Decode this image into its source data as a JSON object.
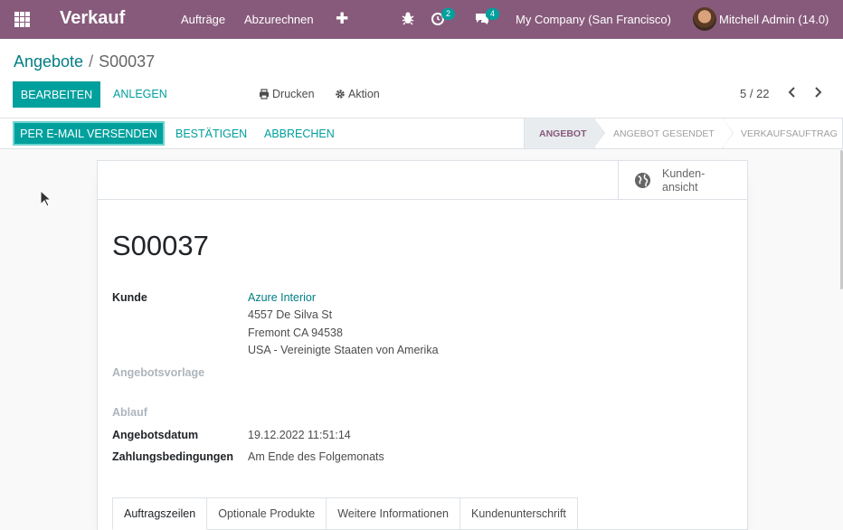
{
  "navbar": {
    "app_name": "Verkauf",
    "menu": [
      "Aufträge",
      "Abzurechnen"
    ],
    "activity_count": "2",
    "message_count": "4",
    "company": "My Company (San Francisco)",
    "user": "Mitchell Admin (14.0)"
  },
  "breadcrumb": {
    "parent": "Angebote",
    "separator": "/",
    "current": "S00037"
  },
  "actions": {
    "edit": "Bearbeiten",
    "create": "Anlegen",
    "print": "Drucken",
    "action": "Aktion"
  },
  "pager": "5 / 22",
  "status_buttons": {
    "send_email": "Per E-Mail versenden",
    "confirm": "Bestätigen",
    "cancel": "Abbrechen"
  },
  "stages": [
    "Angebot",
    "Angebot gesendet",
    "Verkaufsauftrag"
  ],
  "active_stage": "Angebot",
  "smart_button": {
    "label_line1": "Kunden-",
    "label_line2": "ansicht"
  },
  "record": {
    "name": "S00037",
    "customer_label": "Kunde",
    "customer_name": "Azure Interior",
    "address_line1": "4557 De Silva St",
    "address_line2": "Fremont CA 94538",
    "address_line3": "USA - Vereinigte Staaten von Amerika",
    "template_label": "Angebotsvorlage",
    "expiry_label": "Ablauf",
    "date_label": "Angebotsdatum",
    "date_value": "19.12.2022 11:51:14",
    "payment_label": "Zahlungsbedingungen",
    "payment_value": "Am Ende des Folgemonats"
  },
  "tabs": [
    "Auftragszeilen",
    "Optionale Produkte",
    "Weitere Informationen",
    "Kundenunterschrift"
  ],
  "colors": {
    "navbar": "#875a7b",
    "primary": "#00a09d",
    "link": "#017e84"
  }
}
